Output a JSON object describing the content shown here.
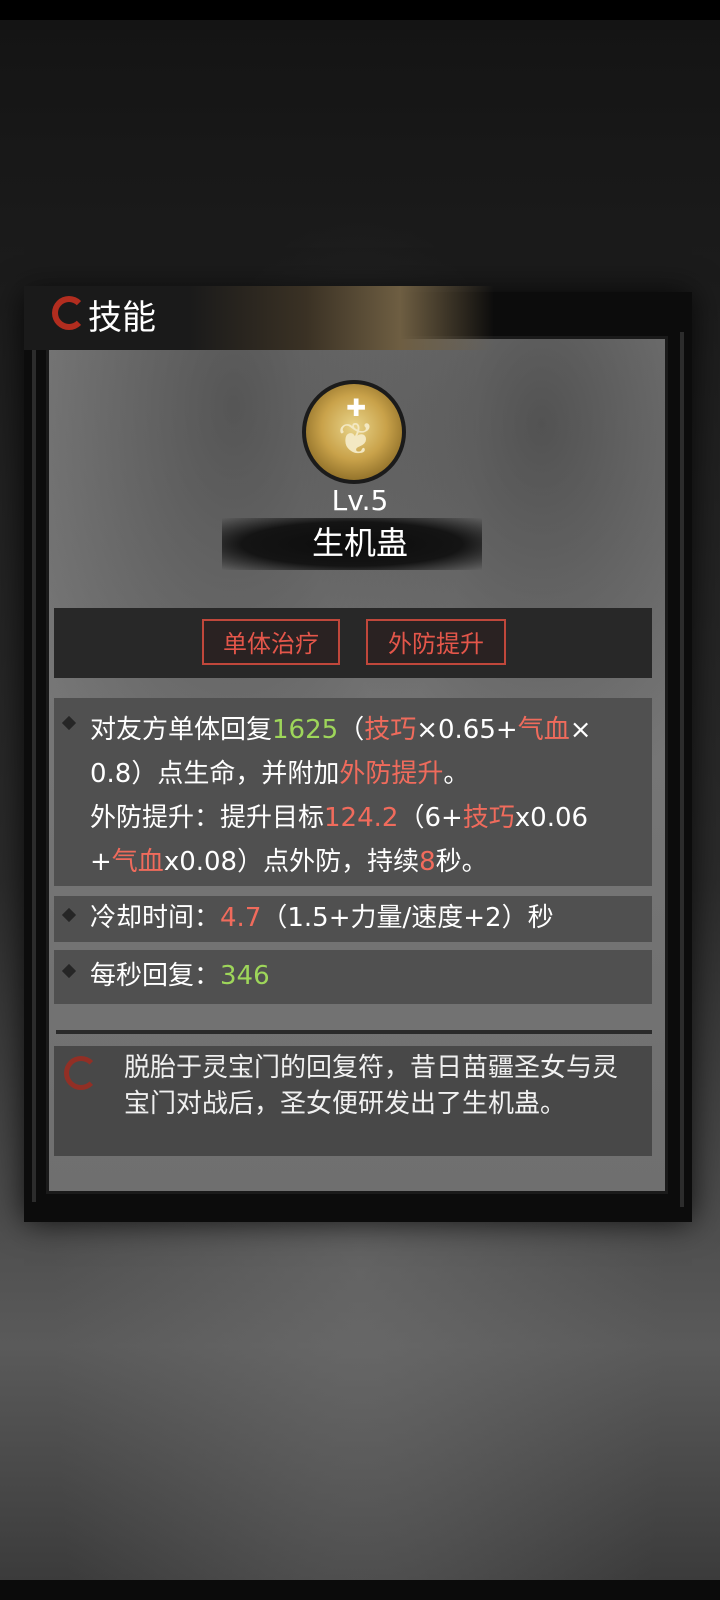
{
  "header": {
    "title": "技能"
  },
  "skill": {
    "level": "Lv.5",
    "name": "生机蛊",
    "tags": [
      "单体治疗",
      "外防提升"
    ]
  },
  "desc": {
    "l1": {
      "a": "对友方单体回复",
      "b": "1625",
      "c": "（",
      "d": "技巧",
      "e": "×0.65+",
      "f": "气血",
      "g": "×"
    },
    "l2": {
      "a": "0.8）点生命，并附加",
      "b": "外防提升",
      "c": "。"
    },
    "l3": {
      "a": "外防提升：提升目标",
      "b": "124.2",
      "c": "（6+",
      "d": "技巧",
      "e": "x0.06"
    },
    "l4": {
      "a": "+",
      "b": "气血",
      "c": "x0.08）点外防，持续",
      "d": "8",
      "e": "秒。"
    }
  },
  "cooldown": {
    "label": "冷却时间：",
    "value": "4.7",
    "formula": "（1.5+力量/速度+2）秒"
  },
  "regen": {
    "label": "每秒回复：",
    "value": "346"
  },
  "lore": "脱胎于灵宝门的回复符，昔日苗疆圣女与灵宝门对战后，圣女便研发出了生机蛊。"
}
